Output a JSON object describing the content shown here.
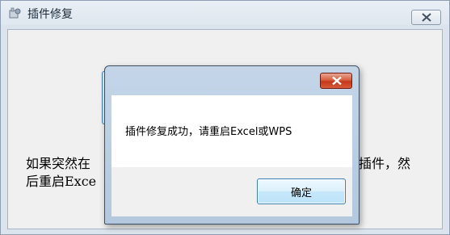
{
  "main_window": {
    "title": "插件修复",
    "icon": "app-icon",
    "close_icon": "close-icon",
    "body_text_line1_start": "如果突然在",
    "body_text_line1_end": "插件，然",
    "body_text_line2_start": "后重启Exce"
  },
  "dialog": {
    "close_icon": "close-icon",
    "message": "插件修复成功，请重启Excel或WPS",
    "ok_label": "确定"
  },
  "colors": {
    "dialog_close_red": "#c5371b",
    "button_border_blue": "#3c7fb1"
  }
}
